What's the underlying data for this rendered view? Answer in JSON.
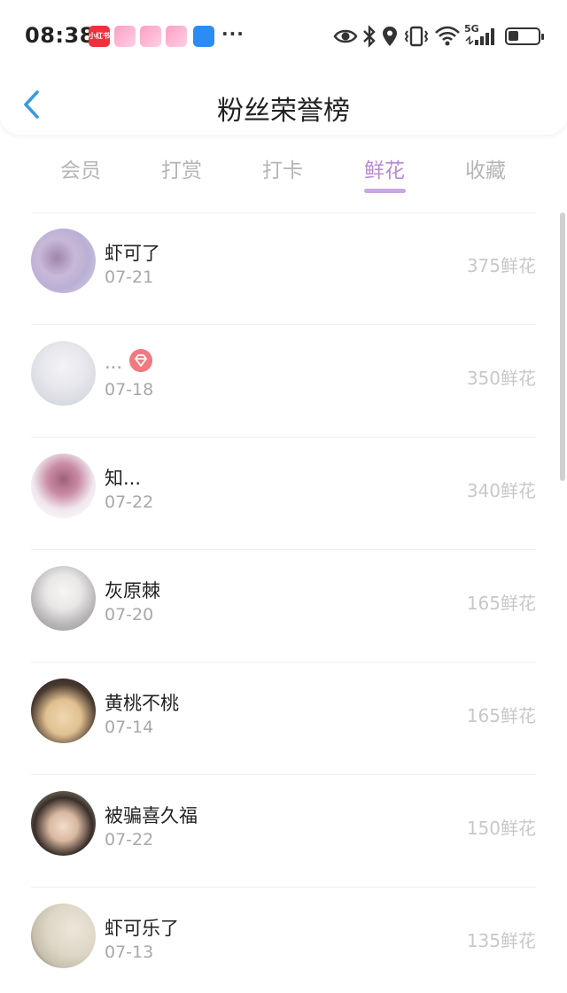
{
  "status_bar": {
    "time": "08:38",
    "app_badge_text": "小红书",
    "more": "···",
    "network_label": "5G"
  },
  "header": {
    "title": "粉丝荣誉榜",
    "back_icon": "chevron-left-icon"
  },
  "tabs": [
    {
      "label": "会员",
      "active": false
    },
    {
      "label": "打赏",
      "active": false
    },
    {
      "label": "打卡",
      "active": false
    },
    {
      "label": "鲜花",
      "active": true
    },
    {
      "label": "收藏",
      "active": false
    }
  ],
  "colors": {
    "accent": "#b88ad6",
    "indicator": "#c9a7e3",
    "back_arrow": "#3a9ae0",
    "badge": "#f07a80"
  },
  "rows": [
    {
      "name": "虾可了",
      "date": "07-21",
      "amount": "375鲜花"
    },
    {
      "name": "...",
      "date": "07-18",
      "amount": "350鲜花"
    },
    {
      "name": "知...",
      "date": "07-22",
      "amount": "340鲜花"
    },
    {
      "name": "灰原棘",
      "date": "07-20",
      "amount": "165鲜花"
    },
    {
      "name": "黄桃不桃",
      "date": "07-14",
      "amount": "165鲜花"
    },
    {
      "name": "被骗喜久福",
      "date": "07-22",
      "amount": "150鲜花"
    },
    {
      "name": "虾可乐了",
      "date": "07-13",
      "amount": "135鲜花"
    }
  ]
}
